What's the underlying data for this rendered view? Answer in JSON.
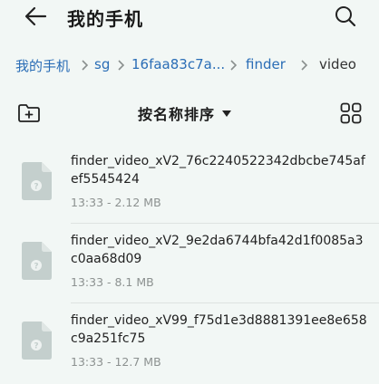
{
  "header": {
    "title": "我的手机"
  },
  "breadcrumb": {
    "items": [
      {
        "label": "我的手机"
      },
      {
        "label": "sg"
      },
      {
        "label": "16faa83c7a..."
      },
      {
        "label": "finder"
      },
      {
        "label": "video"
      }
    ]
  },
  "toolbar": {
    "sort_label": "按名称排序"
  },
  "files": [
    {
      "name": "finder_video_xV2_76c2240522342dbcbe745afef5545424",
      "meta": "13:33 - 2.12 MB"
    },
    {
      "name": "finder_video_xV2_9e2da6744bfa42d1f0085a3c0aa68d09",
      "meta": "13:33 - 8.1 MB"
    },
    {
      "name": "finder_video_xV99_f75d1e3d8881391ee8e658c9a251fc75",
      "meta": "13:33 - 12.7 MB"
    }
  ],
  "colors": {
    "background": "#f2f7f5",
    "link": "#2a6db6",
    "file_icon": "#c4cfcd"
  },
  "icons": [
    "back-arrow-icon",
    "search-icon",
    "new-folder-icon",
    "grid-view-icon",
    "file-icon"
  ]
}
